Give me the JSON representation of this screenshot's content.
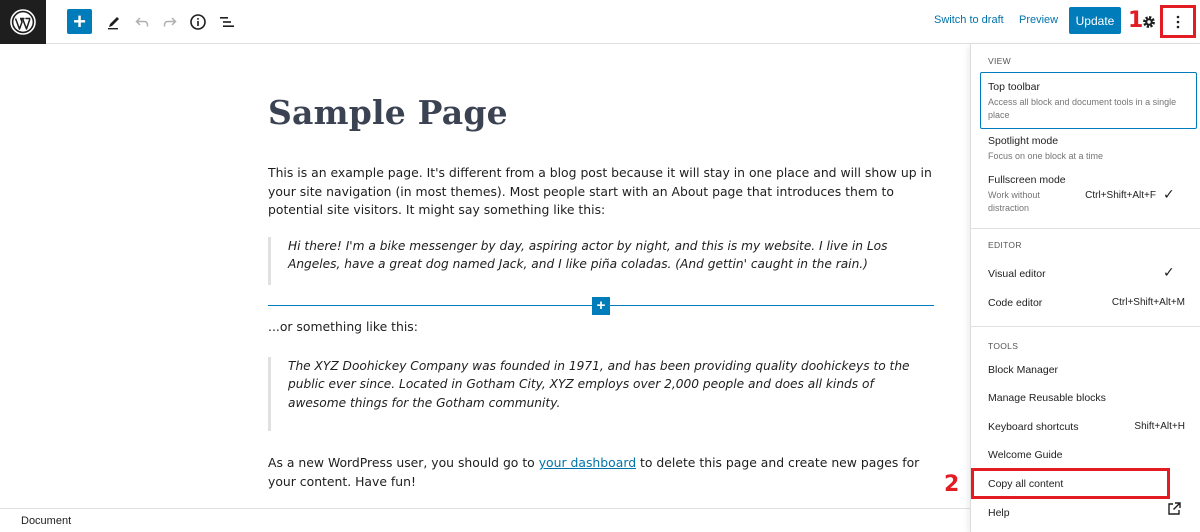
{
  "toolbar": {
    "switch_to_draft": "Switch to draft",
    "preview": "Preview",
    "update": "Update",
    "add_symbol": "+"
  },
  "annotations": {
    "marker_1": "1",
    "marker_2": "2",
    "color": "#e31b23"
  },
  "content": {
    "title": "Sample Page",
    "para1": "This is an example page. It's different from a blog post because it will stay in one place and will show up in your site navigation (in most themes). Most people start with an About page that introduces them to potential site visitors. It might say something like this:",
    "quote1": "Hi there! I'm a bike messenger by day, aspiring actor by night, and this is my website. I live in Los Angeles, have a great dog named Jack, and I like piña coladas. (And gettin' caught in the rain.)",
    "para2": "...or something like this:",
    "quote2": "The XYZ Doohickey Company was founded in 1971, and has been providing quality doohickeys to the public ever since. Located in Gotham City, XYZ employs over 2,000 people and does all kinds of awesome things for the Gotham community.",
    "para3_before": "As a new WordPress user, you should go to ",
    "para3_link": "your dashboard",
    "para3_after": " to delete this page and create new pages for your content. Have fun!",
    "inserter_symbol": "+"
  },
  "footer": {
    "breadcrumb": "Document"
  },
  "menu": {
    "view_label": "VIEW",
    "top_toolbar": "Top toolbar",
    "top_toolbar_desc": "Access all block and document tools in a single place",
    "spotlight": "Spotlight mode",
    "spotlight_desc": "Focus on one block at a time",
    "fullscreen": "Fullscreen mode",
    "fullscreen_desc": "Work without distraction",
    "fullscreen_shortcut": "Ctrl+Shift+Alt+F",
    "editor_label": "EDITOR",
    "visual_editor": "Visual editor",
    "code_editor": "Code editor",
    "code_editor_shortcut": "Ctrl+Shift+Alt+M",
    "tools_label": "TOOLS",
    "block_manager": "Block Manager",
    "manage_reusable": "Manage Reusable blocks",
    "keyboard_shortcuts": "Keyboard shortcuts",
    "keyboard_shortcuts_shortcut": "Shift+Alt+H",
    "welcome_guide": "Welcome Guide",
    "copy_all": "Copy all content",
    "help": "Help",
    "check": "✓"
  }
}
